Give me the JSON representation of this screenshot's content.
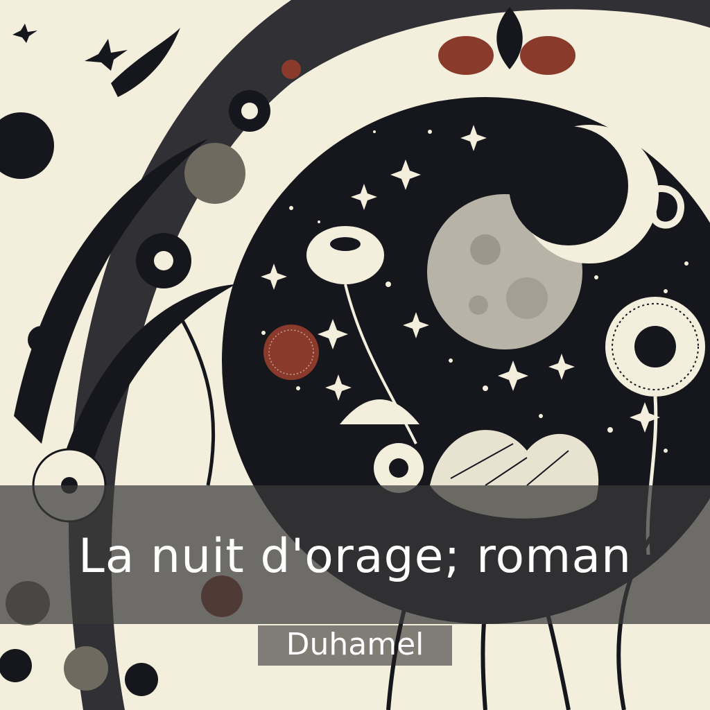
{
  "cover": {
    "title": "La nuit d'orage; roman",
    "author": "Duhamel"
  },
  "colors": {
    "paper": "#f4eedd",
    "ink": "#16161d",
    "rust": "#8a3a2a",
    "moon": "#b7b3a6",
    "band": "#3a3a3a"
  }
}
